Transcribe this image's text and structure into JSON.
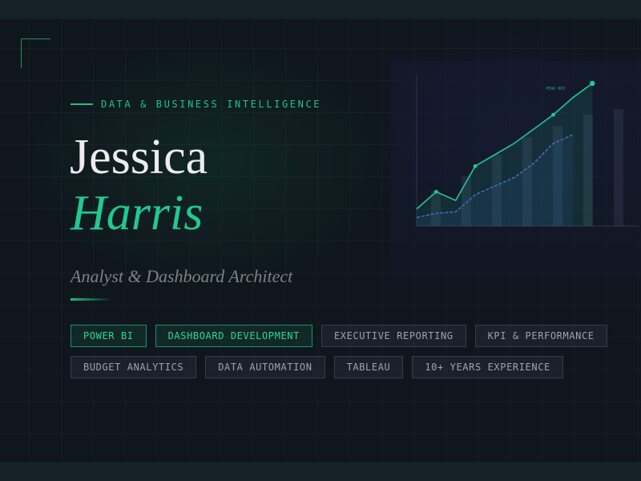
{
  "hero": {
    "eyebrow": "DATA & BUSINESS INTELLIGENCE",
    "first_name": "Jessica",
    "last_name": "Harris",
    "subtitle": "Analyst & Dashboard Architect"
  },
  "tags_row1": [
    {
      "label": "POWER BI",
      "active": true
    },
    {
      "label": "DASHBOARD DEVELOPMENT",
      "active": true
    },
    {
      "label": "EXECUTIVE REPORTING",
      "active": false
    },
    {
      "label": "KPI & PERFORMANCE",
      "active": false
    }
  ],
  "tags_row2": [
    {
      "label": "BUDGET ANALYTICS",
      "active": false
    },
    {
      "label": "DATA AUTOMATION",
      "active": false
    },
    {
      "label": "TABLEAU",
      "active": false
    },
    {
      "label": "10+ YEARS EXPERIENCE",
      "active": false
    }
  ],
  "colors": {
    "background": "#0f161d",
    "accent": "#21c98e",
    "secondary_line": "#4c5fd4",
    "tag_border": "#353c44"
  },
  "chart_data": {
    "type": "line",
    "x": [
      1,
      2,
      3,
      4,
      5,
      6,
      7,
      8,
      9,
      10,
      11,
      12
    ],
    "series": [
      {
        "values": [
          12,
          24,
          18,
          42,
          50,
          58,
          68,
          78,
          90,
          100,
          null,
          null
        ]
      },
      {
        "values": [
          6,
          9,
          10,
          22,
          28,
          34,
          44,
          58,
          64,
          null,
          null,
          null
        ]
      }
    ],
    "bars": [
      25,
      35,
      50,
      62,
      70,
      78,
      82
    ],
    "labels": {
      "peak": "PEAK KPI"
    },
    "ylim": [
      0,
      100
    ]
  }
}
